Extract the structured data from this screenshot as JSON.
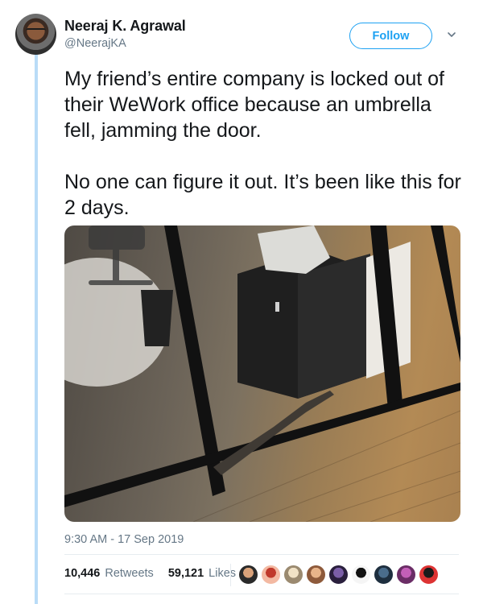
{
  "user": {
    "name": "Neeraj K. Agrawal",
    "handle": "@NeerajKA"
  },
  "follow_label": "Follow",
  "tweet": {
    "paragraph1": "My friend’s entire company is locked out of their WeWork office because an umbrella fell, jamming the door.",
    "paragraph2": "No one can figure it out. It’s been like this for 2 days."
  },
  "timestamp": "9:30 AM - 17 Sep 2019",
  "stats": {
    "retweets_count": "10,446",
    "retweets_label": "Retweets",
    "likes_count": "59,121",
    "likes_label": "Likes"
  },
  "colors": {
    "accent": "#1da1f2",
    "secondary_text": "#657786",
    "thread_line": "#b9dcf7"
  },
  "liker_avatars": [
    "avatar-1",
    "avatar-2",
    "avatar-3",
    "avatar-4",
    "avatar-5",
    "avatar-6",
    "avatar-7",
    "avatar-8",
    "avatar-9"
  ]
}
